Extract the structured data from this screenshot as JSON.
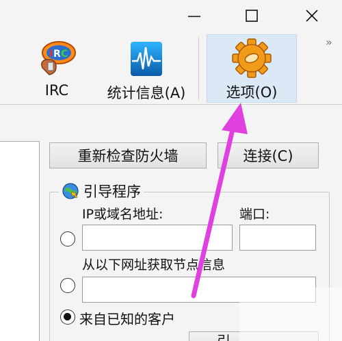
{
  "window_controls": {
    "minimize_icon": "minimize-icon",
    "maximize_icon": "maximize-icon",
    "close_icon": "close-icon"
  },
  "toolbar": {
    "items": [
      {
        "label": "IRC",
        "icon": "irc-chat-icon"
      },
      {
        "label": "统计信息(A)",
        "icon": "statistics-waveform-icon"
      },
      {
        "label": "选项(O)",
        "icon": "options-gear-icon",
        "active": true
      }
    ],
    "overflow_glyph": "»"
  },
  "buttons": {
    "recheck_firewall": "重新检查防火墙",
    "connect": "连接(C)",
    "bottom_partial": "引"
  },
  "bootstrap": {
    "group_title": "引导程序",
    "ip_label": "IP或域名地址:",
    "port_label": "端口:",
    "url_label": "从以下网址获取节点信息",
    "known_clients_label": "来自已知的客户",
    "selected": "known_clients",
    "ip_value": "",
    "port_value": "",
    "url_value": ""
  },
  "colors": {
    "active_tab_bg": "#dbe8f5",
    "annotation_arrow": "#e040e0"
  }
}
